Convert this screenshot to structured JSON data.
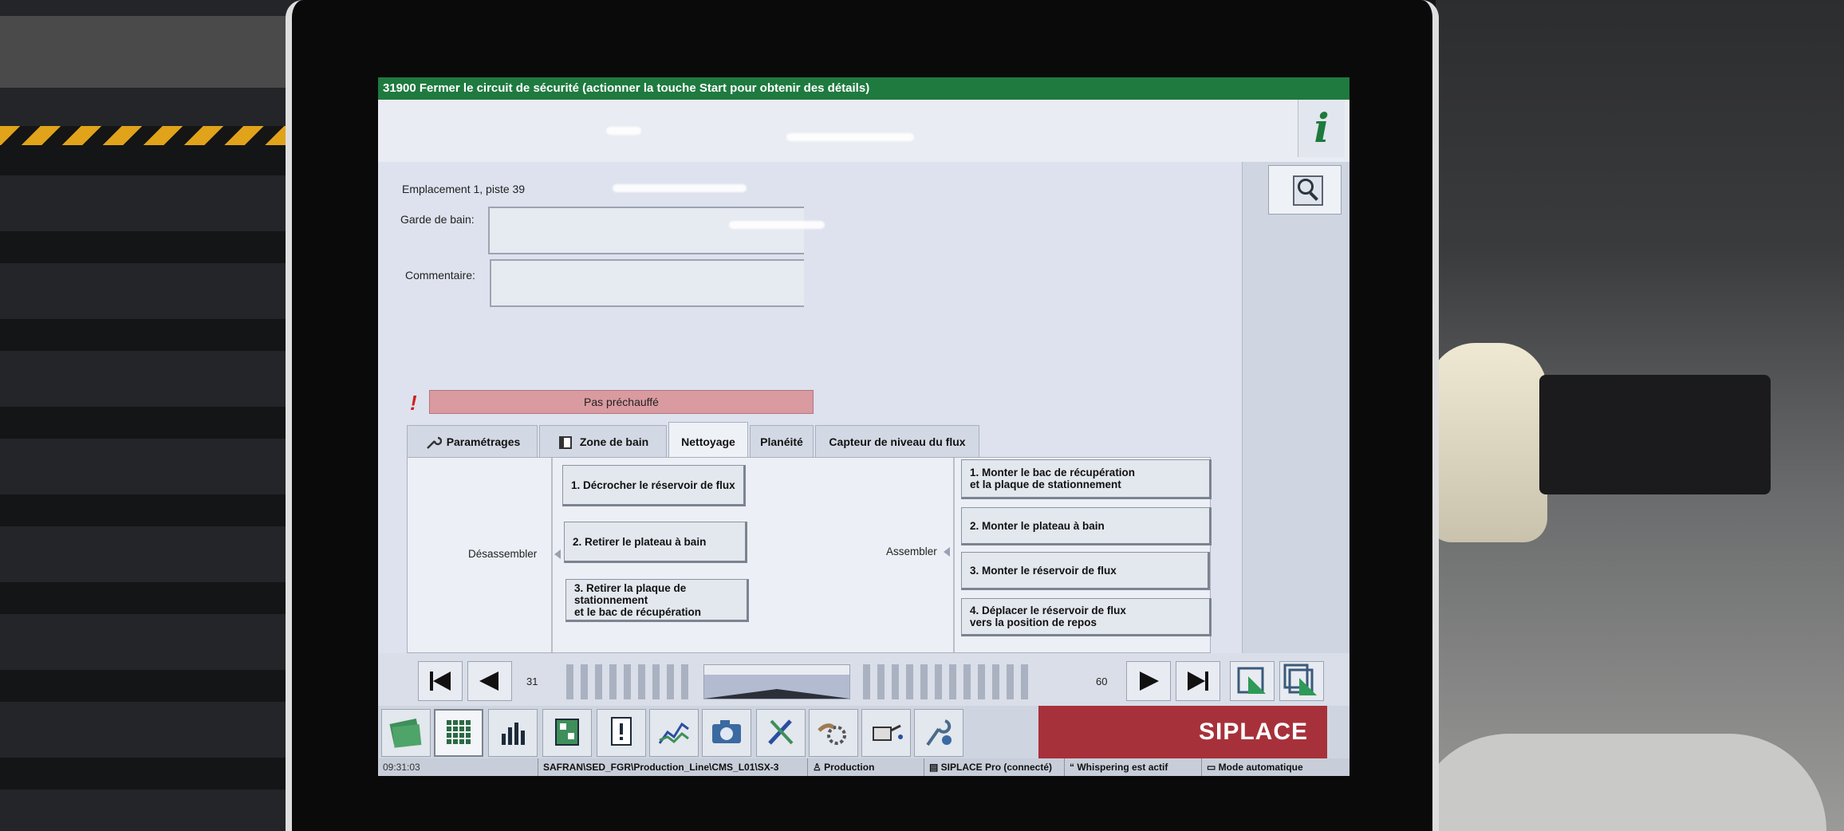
{
  "window": {
    "title": "31900 Fermer le circuit de sécurité (actionner la touche Start pour obtenir des détails)",
    "info_glyph": "i"
  },
  "location": {
    "text": "Emplacement 1, piste 39",
    "bain_label": "Garde de bain:",
    "comment_label": "Commentaire:"
  },
  "status": {
    "exclamation": "!",
    "message": "Pas préchauffé",
    "message_color": "#d99aa0"
  },
  "tabs": [
    {
      "label": "Paramétrages",
      "icon": "wrench-icon"
    },
    {
      "label": "Zone de bain",
      "icon": "bath-icon"
    },
    {
      "label": "Nettoyage",
      "active": true
    },
    {
      "label": "Planéité"
    },
    {
      "label": "Capteur de niveau du flux"
    }
  ],
  "disassemble": {
    "label": "Désassembler",
    "steps": [
      "1. Décrocher le réservoir de flux",
      "2. Retirer le plateau à bain",
      "3. Retirer la plaque de stationnement\net le bac de récupération"
    ]
  },
  "assemble": {
    "label": "Assembler",
    "steps": [
      "1. Monter le bac de récupération\net la plaque de stationnement",
      "2. Monter le plateau à bain",
      "3. Monter le réservoir de flux",
      "4. Déplacer le réservoir de flux\nvers la position de repos"
    ]
  },
  "navigation": {
    "start_num": "31",
    "end_num": "60"
  },
  "brand": {
    "name": "SIPLACE",
    "color": "#a7313a"
  },
  "statusline": {
    "time": "09:31:03",
    "path": "SAFRAN\\SED_FGR\\Production_Line\\CMS_L01\\SX-3",
    "mode": "Production",
    "connection": "SIPLACE Pro (connecté)",
    "whisper": "Whispering est actif",
    "auto": "Mode automatique"
  }
}
